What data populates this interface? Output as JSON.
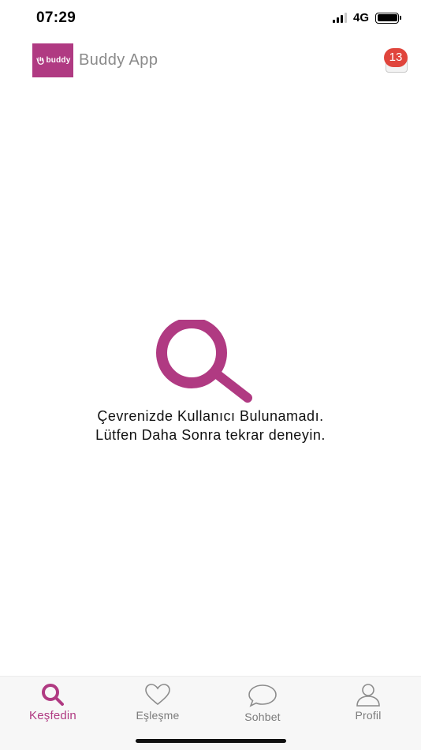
{
  "status_bar": {
    "time": "07:29",
    "network": "4G",
    "icons": [
      "signal-icon",
      "battery-icon"
    ]
  },
  "header": {
    "logo_text": "buddy",
    "title": "Buddy App",
    "notification_count": "13",
    "icons": [
      "notification-icon"
    ]
  },
  "empty_state": {
    "icon": "search-icon",
    "line1": "Çevrenizde Kullanıcı Bulunamadı.",
    "line2": "Lütfen Daha Sonra tekrar deneyin."
  },
  "tabs": [
    {
      "label": "Keşfedin",
      "icon": "search-icon",
      "active": true
    },
    {
      "label": "Eşleşme",
      "icon": "heart-icon",
      "active": false
    },
    {
      "label": "Sohbet",
      "icon": "chat-bubble-icon",
      "active": false
    },
    {
      "label": "Profil",
      "icon": "person-icon",
      "active": false
    }
  ],
  "colors": {
    "accent": "#b03a82",
    "badge": "#e0453c",
    "title_gray": "#8a8a8a",
    "tab_inactive": "#7b7b7b",
    "tab_bar_bg": "#f7f7f7"
  }
}
